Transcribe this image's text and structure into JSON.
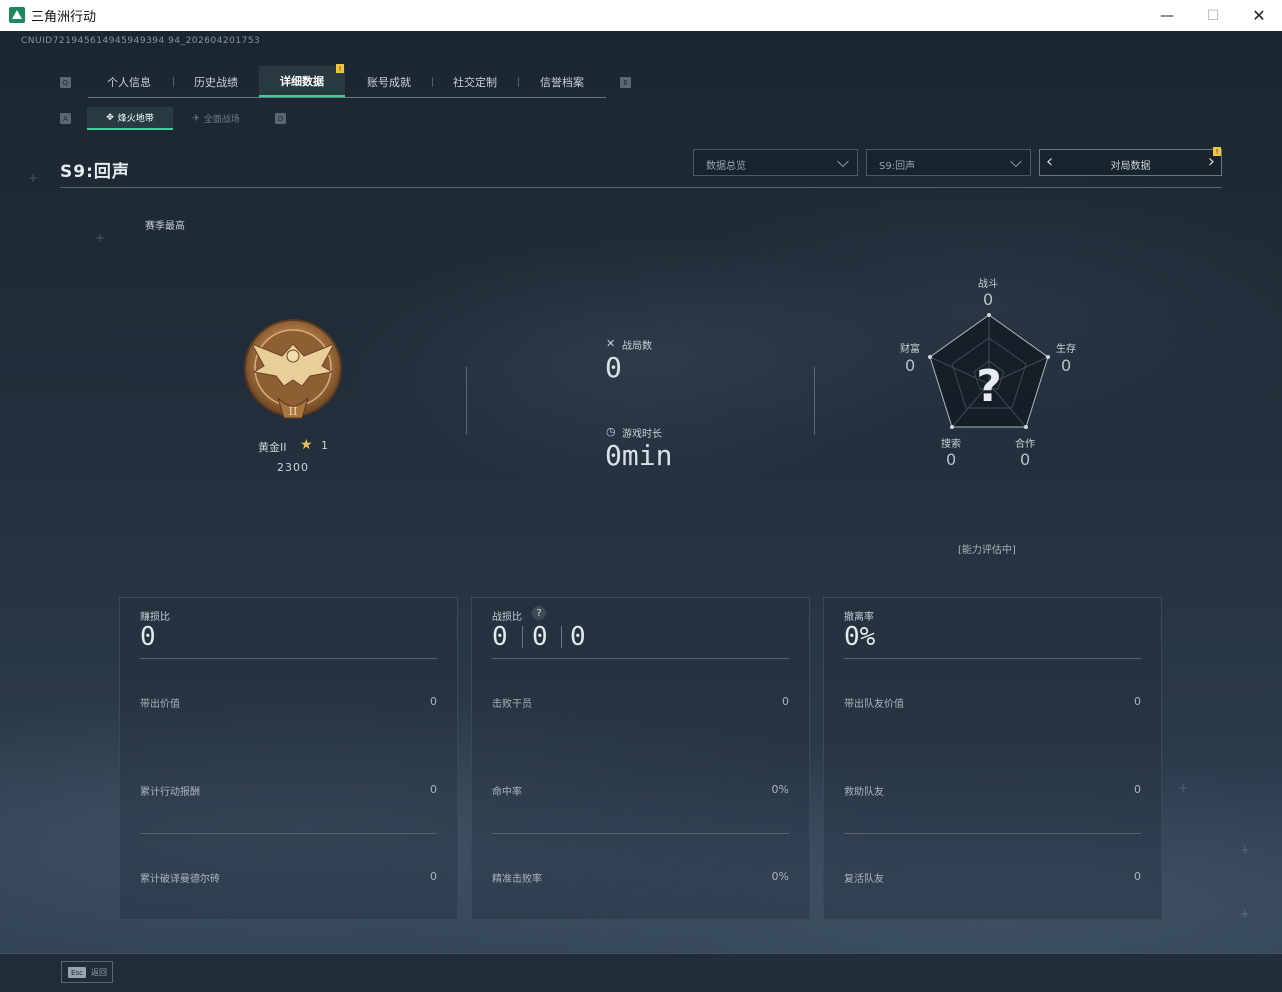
{
  "window": {
    "title": "三角洲行动",
    "minimize": "—",
    "maximize": "☐",
    "close": "✕"
  },
  "uid": "CNUID721945614945949394 94_202604201753",
  "nav": {
    "left_key": "Q",
    "right_key": "E",
    "tabs": [
      {
        "label": "个人信息"
      },
      {
        "label": "历史战绩"
      },
      {
        "label": "详细数据"
      },
      {
        "label": "账号成就"
      },
      {
        "label": "社交定制"
      },
      {
        "label": "信誉档案"
      }
    ],
    "notif": "!"
  },
  "subnav": {
    "left_key": "A",
    "right_key": "D",
    "tabs": [
      {
        "label": "烽火地带"
      },
      {
        "label": "全面战场"
      }
    ]
  },
  "season": {
    "title": "S9:回声",
    "best_label": "赛季最高",
    "dropdown1": "数据总览",
    "dropdown2": "S9:回声",
    "pager": "对局数据",
    "pager_notif": "!"
  },
  "rank": {
    "name": "黄金II",
    "stars": "1",
    "score": "2300",
    "badge_numeral": "II"
  },
  "center": {
    "matches_label": "战局数",
    "matches_value": "0",
    "time_label": "游戏时长",
    "time_value": "0min"
  },
  "radar": {
    "combat_label": "战斗",
    "combat_value": "0",
    "survival_label": "生存",
    "survival_value": "0",
    "cooperation_label": "合作",
    "cooperation_value": "0",
    "search_label": "搜索",
    "search_value": "0",
    "wealth_label": "财富",
    "wealth_value": "0",
    "center_mark": "?",
    "status": "[能力评估中]"
  },
  "panels": {
    "profit": {
      "title": "赚损比",
      "value": "0",
      "rows": [
        {
          "label": "带出价值",
          "value": "0"
        },
        {
          "label": "累计行动报酬",
          "value": "0"
        },
        {
          "label": "累计破译曼德尔砖",
          "value": "0"
        }
      ]
    },
    "kd": {
      "title": "战损比",
      "help": "?",
      "kills": "0",
      "deaths": "0",
      "assists": "0",
      "rows": [
        {
          "label": "击败干员",
          "value": "0"
        },
        {
          "label": "命中率",
          "value": "0%"
        },
        {
          "label": "精准击败率",
          "value": "0%"
        }
      ]
    },
    "extract": {
      "title": "撤离率",
      "value": "0%",
      "rows": [
        {
          "label": "带出队友价值",
          "value": "0"
        },
        {
          "label": "救助队友",
          "value": "0"
        },
        {
          "label": "复活队友",
          "value": "0"
        }
      ]
    }
  },
  "bottom": {
    "esc_key": "Esc",
    "esc_label": "返回"
  }
}
